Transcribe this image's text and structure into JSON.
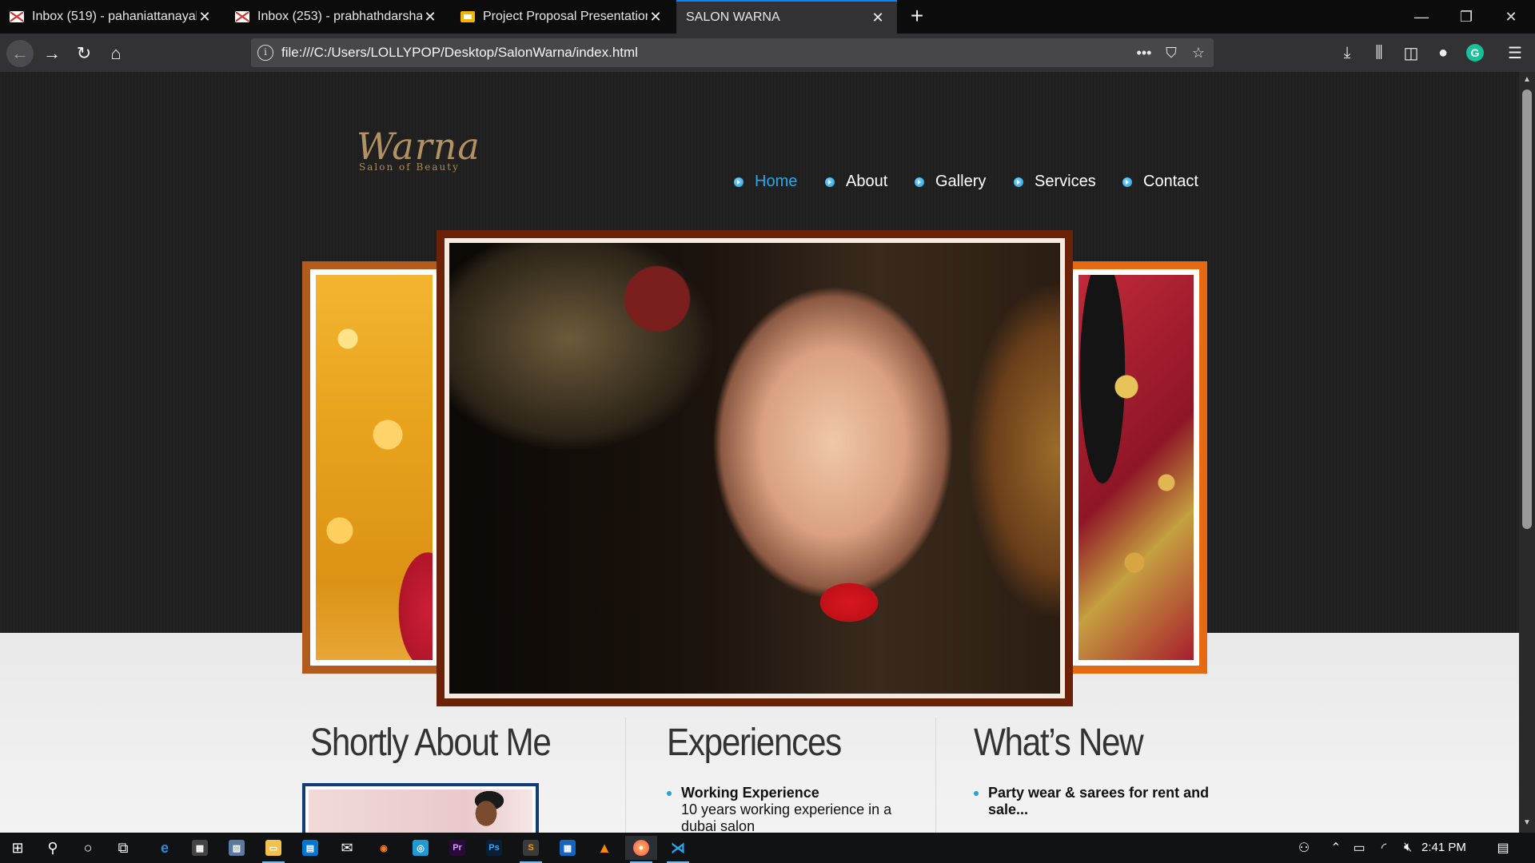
{
  "browser": {
    "tabs": [
      {
        "title": "Inbox (519) - pahaniattanayake",
        "icon": "gmail-icon",
        "active": false
      },
      {
        "title": "Inbox (253) - prabhathdarshana",
        "icon": "gmail-icon",
        "active": false
      },
      {
        "title": "Project Proposal Presentation - ",
        "icon": "google-slides-icon",
        "active": false
      },
      {
        "title": "SALON WARNA",
        "icon": "",
        "active": true
      }
    ],
    "url": "file:///C:/Users/LOLLYPOP/Desktop/SalonWarna/index.html"
  },
  "site": {
    "logo_script": "Warna",
    "logo_tagline": "Salon of Beauty",
    "nav": [
      {
        "label": "Home",
        "active": true
      },
      {
        "label": "About",
        "active": false
      },
      {
        "label": "Gallery",
        "active": false
      },
      {
        "label": "Services",
        "active": false
      },
      {
        "label": "Contact",
        "active": false
      }
    ],
    "sections": {
      "about": {
        "title": "Shortly About Me"
      },
      "experiences": {
        "title": "Experiences",
        "item_title": "Working Experience",
        "item_text": "10 years working experience in a dubai salon"
      },
      "news": {
        "title": "What’s New",
        "item_title": "Party wear & sarees for rent and sale..."
      }
    }
  },
  "taskbar": {
    "clock": "2:41 PM"
  },
  "colors": {
    "nav_active": "#22aaee",
    "accent_bullet": "#1ea4e6",
    "logo_gold": "#b29262",
    "tab_active_border": "#0a84ff"
  }
}
